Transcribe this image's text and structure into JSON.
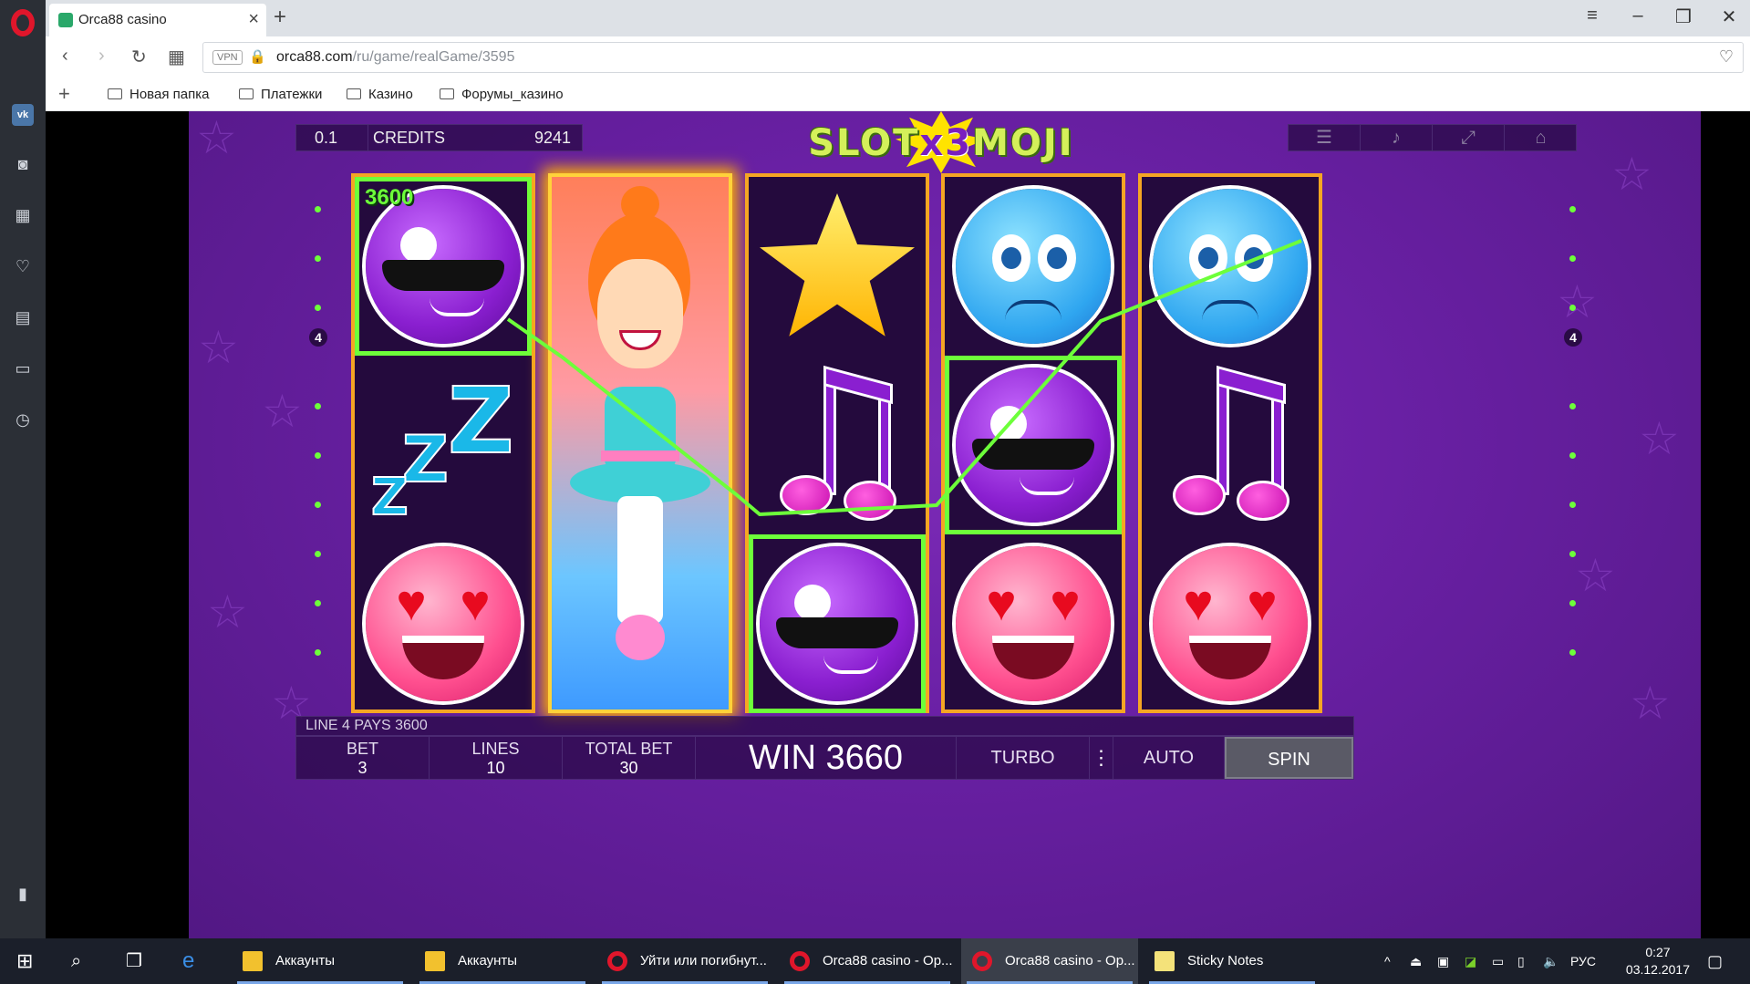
{
  "browser": {
    "tab_title": "Orca88 casino",
    "url_host": "orca88.com",
    "url_path": "/ru/game/realGame/3595",
    "vpn_label": "VPN",
    "bookmarks": [
      "Новая папка",
      "Платежки",
      "Казино",
      "Форумы_казино"
    ]
  },
  "game": {
    "logo_text_left": "SLOT",
    "logo_x3": "x3",
    "logo_text_right": "MOJI",
    "denomination": "0.1",
    "credits_label": "CREDITS",
    "credits_value": "9241",
    "win_amount_badge": "3600",
    "line_indicator_left": "4",
    "line_indicator_right": "4",
    "reels": [
      [
        "cool-emoji",
        "zzz",
        "heart-eyes-emoji"
      ],
      [
        "ballerina-wild"
      ],
      [
        "star",
        "music-note",
        "cool-emoji"
      ],
      [
        "sad-emoji",
        "cool-emoji",
        "heart-eyes-emoji"
      ],
      [
        "sad-emoji",
        "music-note",
        "heart-eyes-emoji"
      ]
    ],
    "status_text": "LINE 4 PAYS 3600",
    "bet_label": "BET",
    "bet_value": "3",
    "lines_label": "LINES",
    "lines_value": "10",
    "total_bet_label": "TOTAL BET",
    "total_bet_value": "30",
    "win_text": "WIN 3660",
    "turbo_label": "TURBO",
    "auto_label": "AUTO",
    "spin_label": "SPIN",
    "colors": {
      "win_line": "#6dff3a",
      "reel_border": "#f5a623",
      "background": "#6a20a5"
    }
  },
  "taskbar": {
    "apps": [
      {
        "label": "Аккаунты",
        "icon": "folder"
      },
      {
        "label": "Аккаунты",
        "icon": "folder"
      },
      {
        "label": "Уйти или погибнут...",
        "icon": "opera"
      },
      {
        "label": "Orca88 casino - Op...",
        "icon": "opera"
      },
      {
        "label": "Orca88 casino - Op...",
        "icon": "opera"
      },
      {
        "label": "Sticky Notes",
        "icon": "sticky-notes"
      }
    ],
    "language": "РУС",
    "time": "0:27",
    "date": "03.12.2017"
  }
}
